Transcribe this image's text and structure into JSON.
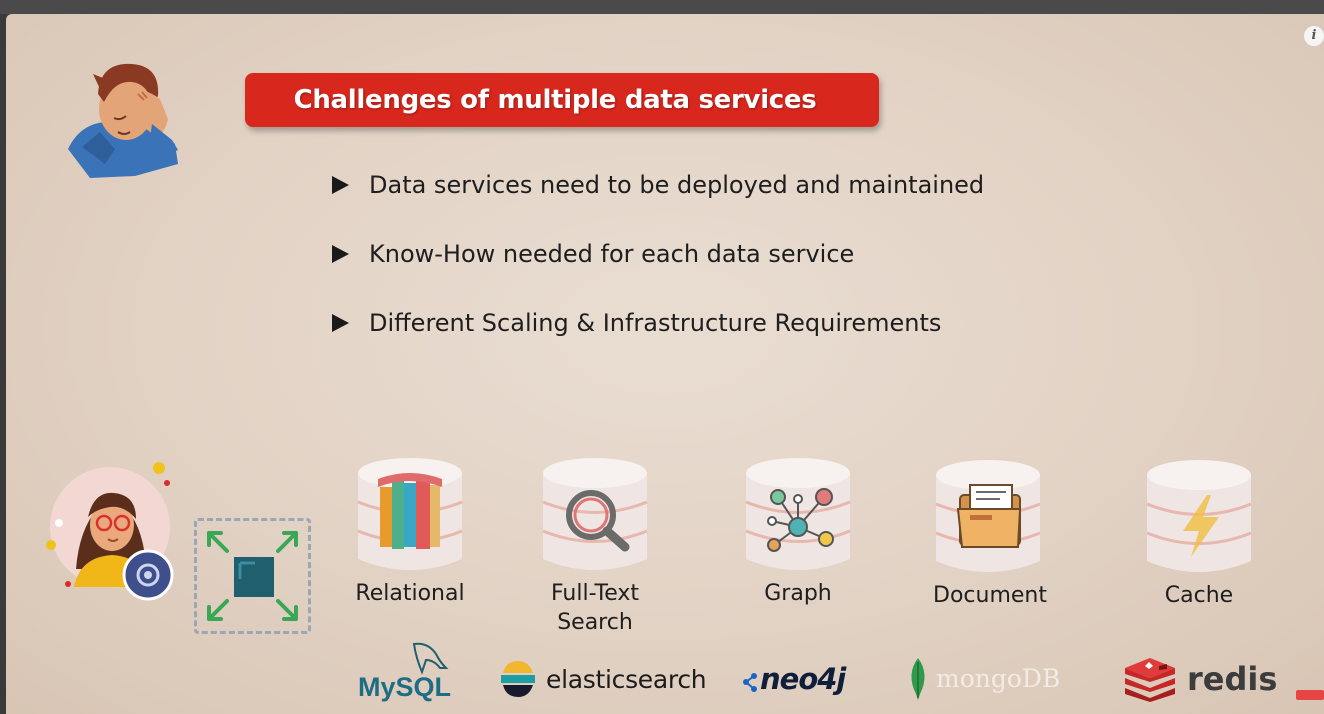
{
  "window": {
    "info_icon": "i"
  },
  "slide": {
    "title": "Challenges of multiple data services",
    "bullets": [
      "Data services need to be deployed and maintained",
      "Know-How needed for each data service",
      "Different Scaling & Infrastructure Requirements"
    ],
    "databases": [
      {
        "label": "Relational",
        "icon": "bookshelf-icon"
      },
      {
        "label": "Full-Text",
        "label2": "Search",
        "icon": "magnifier-icon"
      },
      {
        "label": "Graph",
        "icon": "network-graph-icon"
      },
      {
        "label": "Document",
        "icon": "folder-document-icon"
      },
      {
        "label": "Cache",
        "icon": "lightning-icon"
      }
    ],
    "logos": {
      "mysql": "MySQL",
      "elasticsearch": "elasticsearch",
      "neo4j": "neo4j",
      "mongodb": "mongoDB",
      "redis": "redis"
    },
    "colors": {
      "banner": "#d8271d",
      "accent_green": "#3aa757",
      "dark_teal": "#1f5f6e"
    }
  }
}
